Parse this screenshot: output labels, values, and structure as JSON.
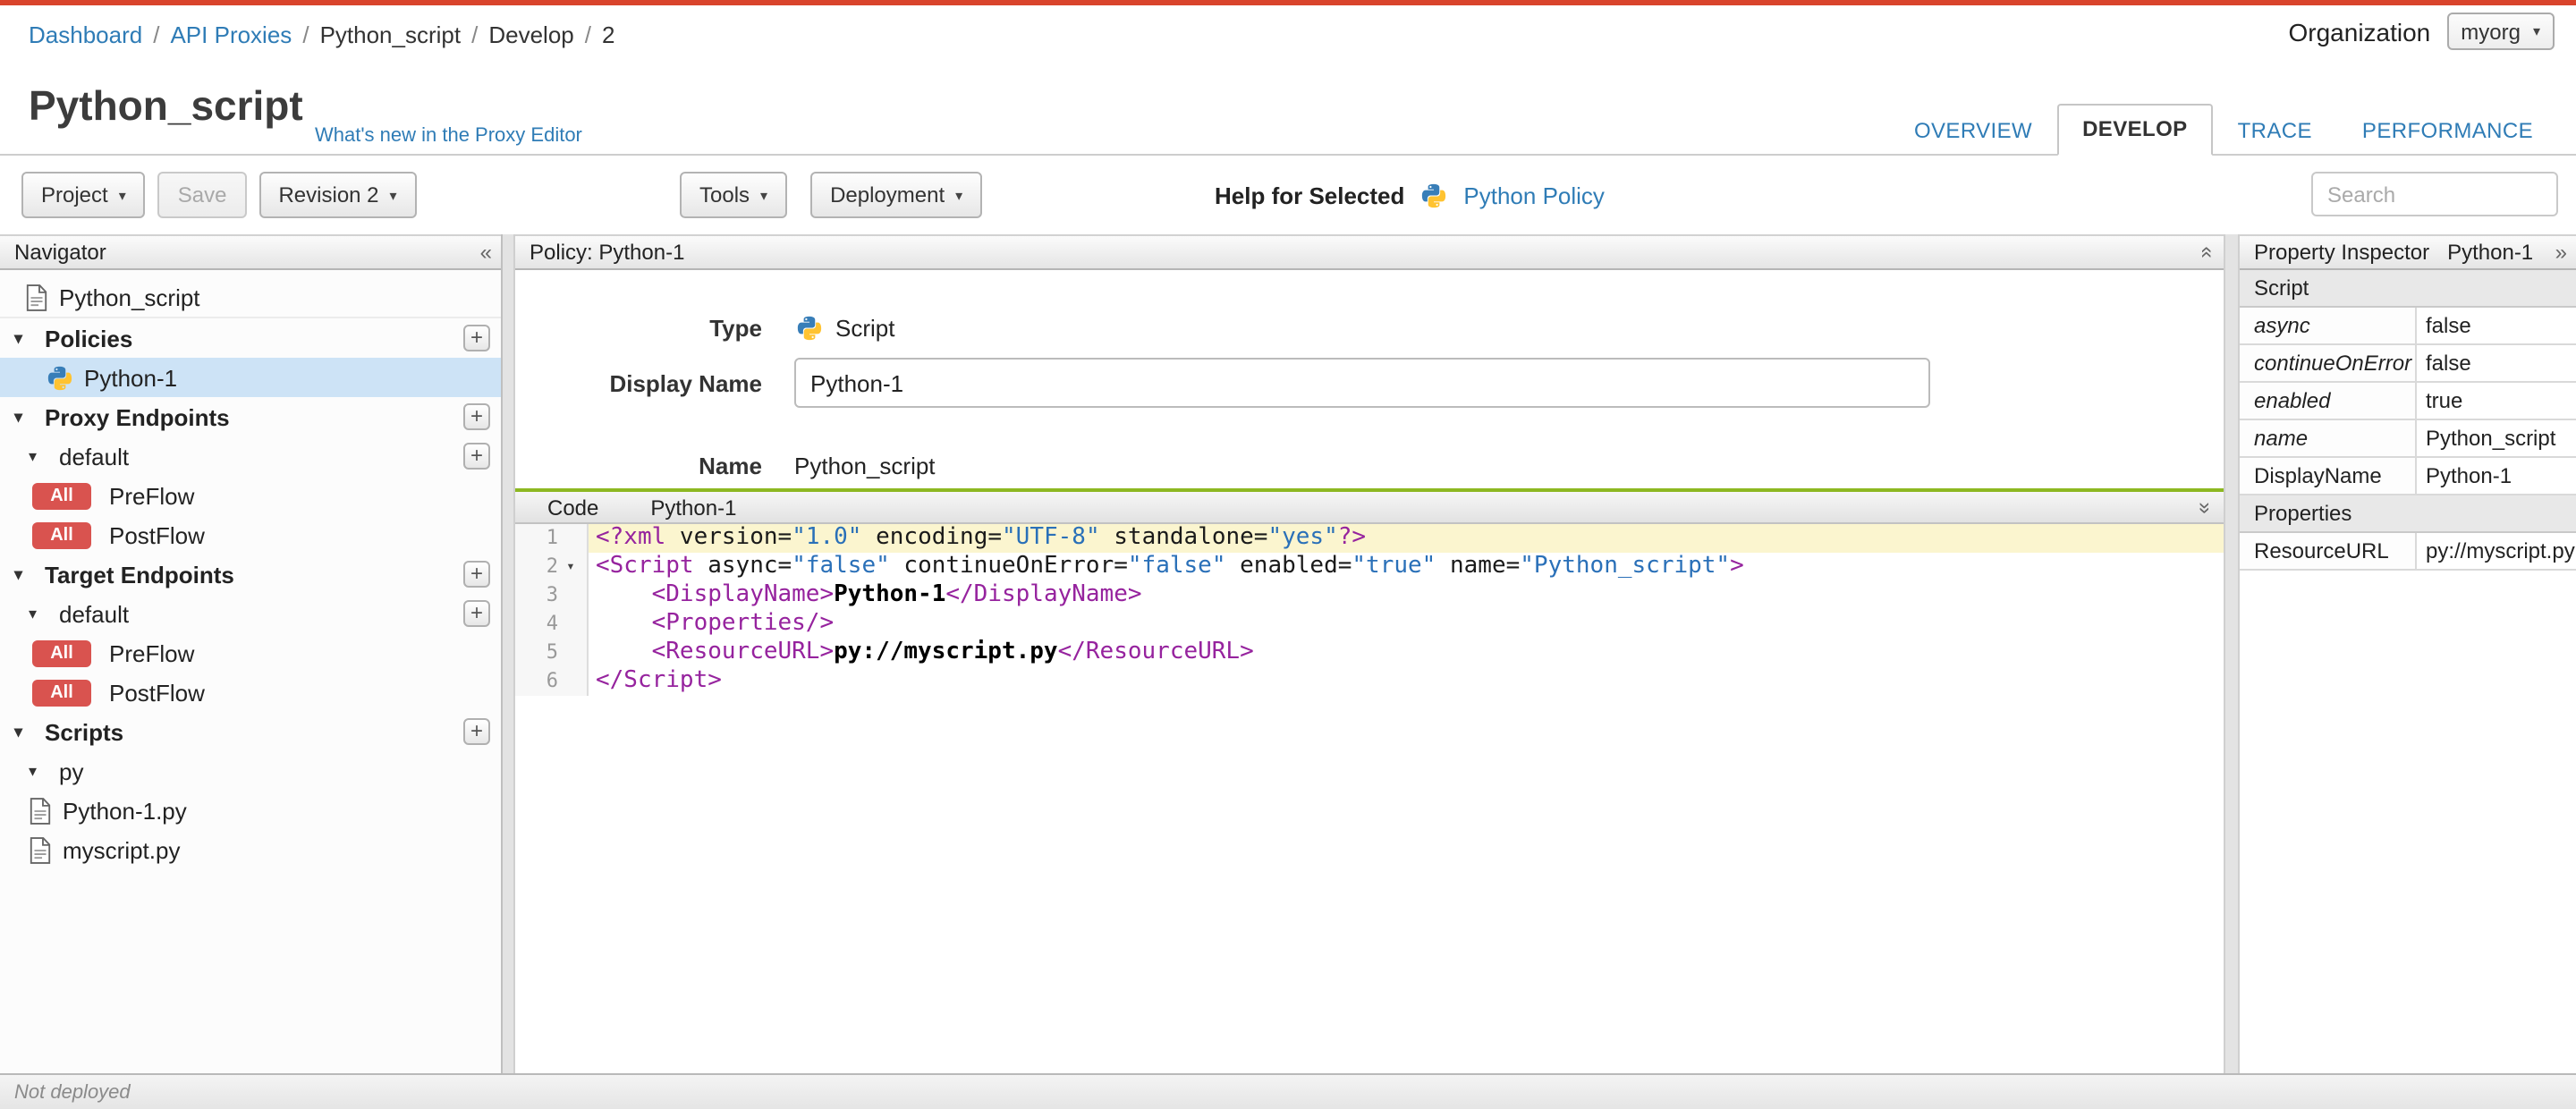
{
  "topbar": {
    "breadcrumb": [
      {
        "label": "Dashboard",
        "link": true
      },
      {
        "label": "API Proxies",
        "link": true
      },
      {
        "label": "Python_script",
        "link": false
      },
      {
        "label": "Develop",
        "link": false
      },
      {
        "label": "2",
        "link": false
      }
    ],
    "org_label": "Organization",
    "org_value": "myorg"
  },
  "header": {
    "title": "Python_script",
    "whats_new": "What's new in the Proxy Editor",
    "tabs": [
      {
        "label": "OVERVIEW",
        "active": false
      },
      {
        "label": "DEVELOP",
        "active": true
      },
      {
        "label": "TRACE",
        "active": false
      },
      {
        "label": "PERFORMANCE",
        "active": false
      }
    ]
  },
  "toolbar": {
    "project_label": "Project",
    "save_label": "Save",
    "revision_label": "Revision 2",
    "tools_label": "Tools",
    "deployment_label": "Deployment",
    "help_label": "Help for Selected",
    "help_link": "Python Policy",
    "search_placeholder": "Search"
  },
  "navigator": {
    "title": "Navigator",
    "items": [
      {
        "kind": "root",
        "label": "Python_script",
        "icon": "file"
      },
      {
        "kind": "section",
        "label": "Policies",
        "plus": true
      },
      {
        "kind": "policy",
        "label": "Python-1",
        "icon": "python",
        "selected": true
      },
      {
        "kind": "section",
        "label": "Proxy Endpoints",
        "plus": true
      },
      {
        "kind": "sub",
        "label": "default",
        "plus": true
      },
      {
        "kind": "flow",
        "badge": "All",
        "label": "PreFlow"
      },
      {
        "kind": "flow",
        "badge": "All",
        "label": "PostFlow"
      },
      {
        "kind": "section",
        "label": "Target Endpoints",
        "plus": true
      },
      {
        "kind": "sub",
        "label": "default",
        "plus": true
      },
      {
        "kind": "flow",
        "badge": "All",
        "label": "PreFlow"
      },
      {
        "kind": "flow",
        "badge": "All",
        "label": "PostFlow"
      },
      {
        "kind": "section",
        "label": "Scripts",
        "plus": true
      },
      {
        "kind": "sub",
        "label": "py"
      },
      {
        "kind": "file",
        "label": "Python-1.py",
        "icon": "file"
      },
      {
        "kind": "file",
        "label": "myscript.py",
        "icon": "file"
      }
    ]
  },
  "policy": {
    "header": "Policy: Python-1",
    "type_label": "Type",
    "type_value": "Script",
    "display_name_label": "Display Name",
    "display_name_value": "Python-1",
    "name_label": "Name",
    "name_value": "Python_script"
  },
  "code": {
    "tab_label": "Code",
    "title": "Python-1",
    "lines": [
      {
        "num": 1,
        "highlight": true,
        "fold": false,
        "tokens": [
          {
            "c": "tag",
            "v": "<?xml"
          },
          {
            "c": "attr",
            "v": " version="
          },
          {
            "c": "str",
            "v": "\"1.0\""
          },
          {
            "c": "attr",
            "v": " encoding="
          },
          {
            "c": "str",
            "v": "\"UTF-8\""
          },
          {
            "c": "attr",
            "v": " standalone="
          },
          {
            "c": "str",
            "v": "\"yes\""
          },
          {
            "c": "tag",
            "v": "?>"
          }
        ]
      },
      {
        "num": 2,
        "highlight": false,
        "fold": true,
        "tokens": [
          {
            "c": "tag",
            "v": "<Script"
          },
          {
            "c": "attr",
            "v": " async="
          },
          {
            "c": "str",
            "v": "\"false\""
          },
          {
            "c": "attr",
            "v": " continueOnError="
          },
          {
            "c": "str",
            "v": "\"false\""
          },
          {
            "c": "attr",
            "v": " enabled="
          },
          {
            "c": "str",
            "v": "\"true\""
          },
          {
            "c": "attr",
            "v": " name="
          },
          {
            "c": "str",
            "v": "\"Python_script\""
          },
          {
            "c": "tag",
            "v": ">"
          }
        ]
      },
      {
        "num": 3,
        "highlight": false,
        "fold": false,
        "tokens": [
          {
            "c": "text",
            "v": "    "
          },
          {
            "c": "tag",
            "v": "<DisplayName>"
          },
          {
            "c": "text",
            "v": "Python-1"
          },
          {
            "c": "tag",
            "v": "</DisplayName>"
          }
        ]
      },
      {
        "num": 4,
        "highlight": false,
        "fold": false,
        "tokens": [
          {
            "c": "text",
            "v": "    "
          },
          {
            "c": "tag",
            "v": "<Properties/>"
          }
        ]
      },
      {
        "num": 5,
        "highlight": false,
        "fold": false,
        "tokens": [
          {
            "c": "text",
            "v": "    "
          },
          {
            "c": "tag",
            "v": "<ResourceURL>"
          },
          {
            "c": "text",
            "v": "py://myscript.py"
          },
          {
            "c": "tag",
            "v": "</ResourceURL>"
          }
        ]
      },
      {
        "num": 6,
        "highlight": false,
        "fold": false,
        "tokens": [
          {
            "c": "tag",
            "v": "</Script>"
          }
        ]
      }
    ]
  },
  "inspector": {
    "title": "Property Inspector",
    "subtitle": "Python-1",
    "rows": [
      {
        "kind": "section",
        "label": "Script"
      },
      {
        "kind": "prop",
        "name": "async",
        "italic": true,
        "value": "false"
      },
      {
        "kind": "prop",
        "name": "continueOnError",
        "italic": true,
        "value": "false"
      },
      {
        "kind": "prop",
        "name": "enabled",
        "italic": true,
        "value": "true"
      },
      {
        "kind": "prop",
        "name": "name",
        "italic": true,
        "value": "Python_script"
      },
      {
        "kind": "prop",
        "name": "DisplayName",
        "italic": false,
        "value": "Python-1"
      },
      {
        "kind": "section",
        "label": "Properties"
      },
      {
        "kind": "prop",
        "name": "ResourceURL",
        "italic": false,
        "value": "py://myscript.py"
      }
    ]
  },
  "statusbar": {
    "text": "Not deployed"
  },
  "colors": {
    "accent_red": "#d9442c",
    "link_blue": "#2f7cb6",
    "code_saved_green": "#8db822",
    "selected_row_blue": "#cde3f6",
    "badge_red": "#d9534f",
    "tag_purple": "#96239e",
    "string_blue": "#2a70b8",
    "line_highlight": "#fbf5cf"
  }
}
